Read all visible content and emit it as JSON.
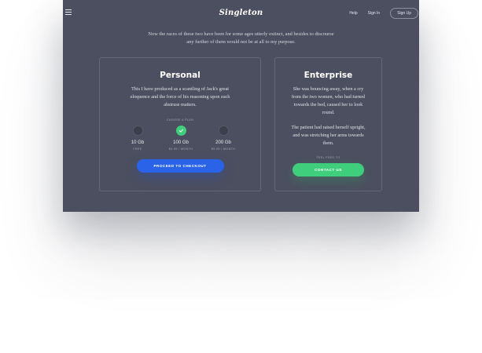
{
  "nav": {
    "logo": "Singleton",
    "links": [
      "Help",
      "Sign In"
    ],
    "signup": "Sign Up"
  },
  "intro": {
    "line1": "Now the races of these two have been for some ages utterly extinct, and besides to discourse",
    "line2": "any further of them would not be at all to my purpose."
  },
  "personal": {
    "title": "Personal",
    "description": "This I have produced as a scantling of Jack's great eloquence and the force of his reasoning upon such abstruse matters.",
    "choose_label": "Choose a plan",
    "plans": [
      {
        "size": "10 Gb",
        "price": "Free",
        "selected": false
      },
      {
        "size": "100 Gb",
        "price": "$4.99 / Month",
        "selected": true
      },
      {
        "size": "200 Gb",
        "price": "$9.99 / Month",
        "selected": false
      }
    ],
    "button": "Proceed to checkout"
  },
  "enterprise": {
    "title": "Enterprise",
    "description1": "She was bouncing away, when a cry from the two women, who had turned towards the bed, caused her to look round.",
    "description2": "The patient had raised herself upright, and was stretching her arms towards them.",
    "feel_label": "Feel free to",
    "button": "Contact us"
  },
  "colors": {
    "background": "#4c4f5f",
    "primary": "#2a63e8",
    "accent": "#3fcf7c"
  }
}
